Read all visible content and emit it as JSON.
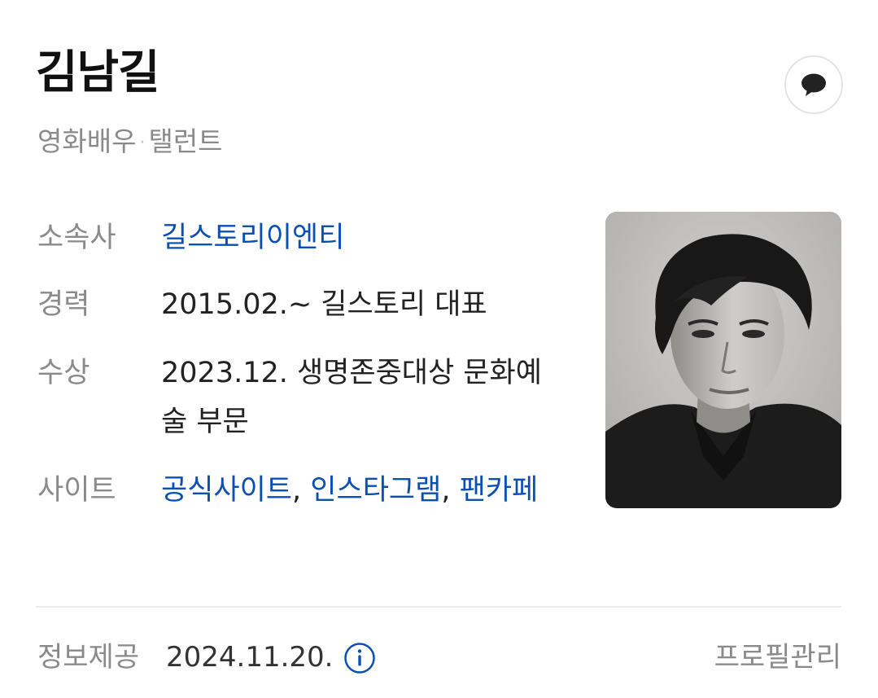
{
  "profile": {
    "name": "김남길",
    "occupation_1": "영화배우",
    "occupation_separator": "·",
    "occupation_2": "탤런트"
  },
  "details": {
    "agency_label": "소속사",
    "agency_value": "길스토리이엔티",
    "career_label": "경력",
    "career_value": "2015.02.~ 길스토리 대표",
    "award_label": "수상",
    "award_value": "2023.12. 생명존중대상 문화예술 부문",
    "site_label": "사이트",
    "site_link_1": "공식사이트",
    "site_link_2": "인스타그램",
    "site_link_3": "팬카페",
    "site_separator": ","
  },
  "footer": {
    "info_label": "정보제공",
    "info_date": "2024.11.20.",
    "manage_label": "프로필관리"
  },
  "icons": {
    "comment": "speech-bubble-icon",
    "info": "info-circle-icon"
  },
  "colors": {
    "link": "#0b4fb3",
    "label": "#8a8a8a",
    "info_icon": "#0b4fb3"
  }
}
